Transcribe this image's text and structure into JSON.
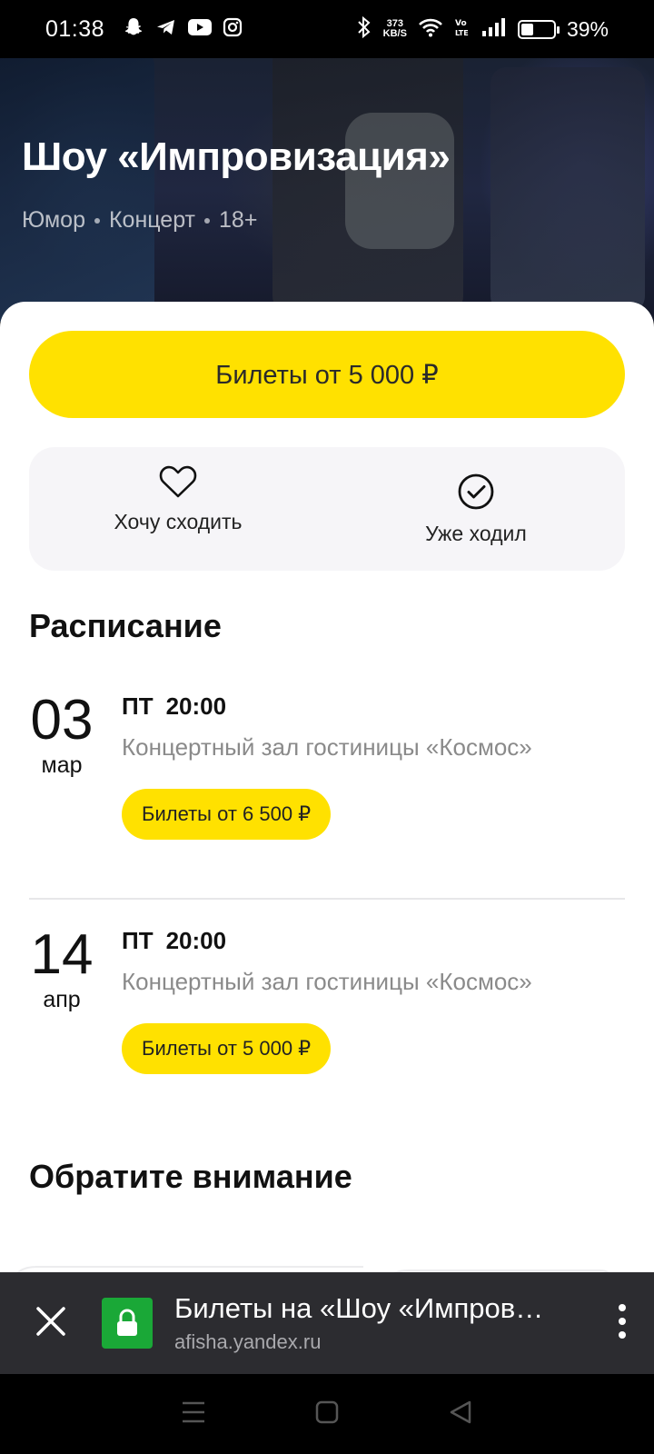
{
  "status_bar": {
    "time": "01:38",
    "net_speed_value": "373",
    "net_speed_unit": "KB/S",
    "battery_percent": "39%",
    "battery_level": 0.39,
    "icons": [
      "snapchat-icon",
      "telegram-icon",
      "youtube-icon",
      "instagram-icon",
      "bluetooth-icon",
      "wifi-icon",
      "volte-icon",
      "signal-icon",
      "battery-icon"
    ]
  },
  "hero": {
    "title": "Шоу «Импровизация»",
    "tags": [
      "Юмор",
      "Концерт",
      "18+"
    ]
  },
  "main_buy_label": "Билеты от 5 000 ₽",
  "actions": {
    "want_label": "Хочу сходить",
    "visited_label": "Уже ходил"
  },
  "schedule": {
    "title": "Расписание",
    "sessions": [
      {
        "day": "03",
        "month": "мар",
        "weekday": "ПТ",
        "time": "20:00",
        "venue": "Концертный зал гостиницы «Космос»",
        "buy_label": "Билеты от 6 500 ₽"
      },
      {
        "day": "14",
        "month": "апр",
        "weekday": "ПТ",
        "time": "20:00",
        "venue": "Концертный зал гостиницы «Космос»",
        "buy_label": "Билеты от 5 000 ₽"
      }
    ]
  },
  "attention_title": "Обратите внимание",
  "browser": {
    "page_title": "Билеты на «Шоу «Импров…",
    "domain": "afisha.yandex.ru"
  },
  "colors": {
    "accent_yellow": "#ffe100",
    "secure_green": "#1aa837",
    "browser_bar": "#2c2c30"
  }
}
